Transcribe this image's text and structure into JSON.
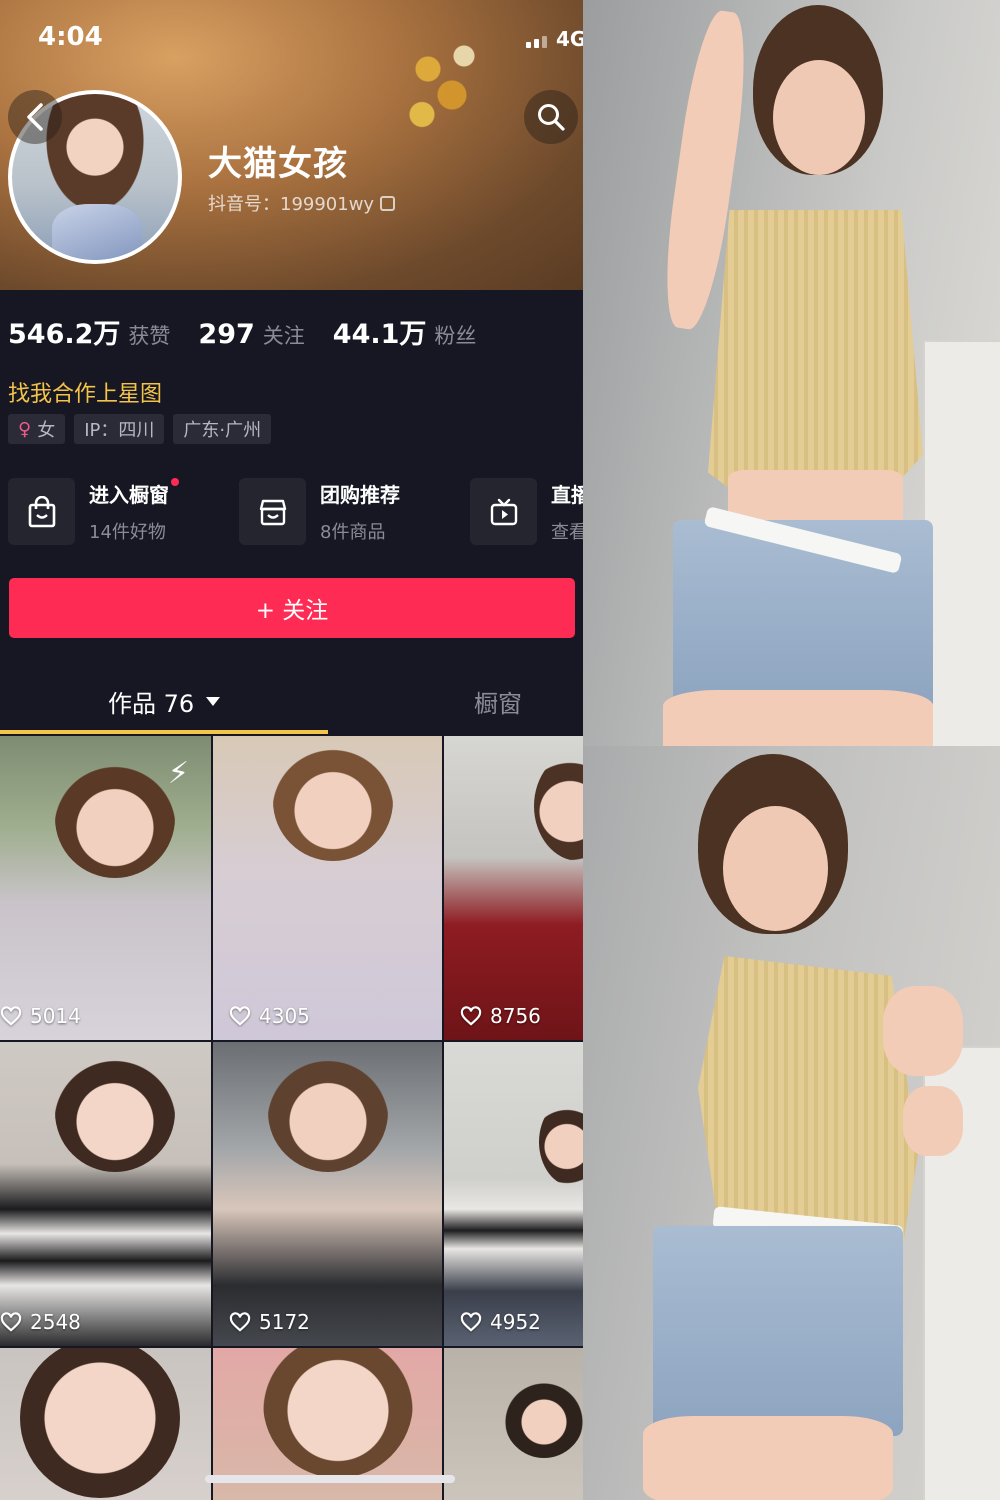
{
  "status": {
    "time": "4:04",
    "network": "4G"
  },
  "profile": {
    "nickname": "大猫女孩",
    "douyin_id": "抖音号：199901wy",
    "stats": [
      {
        "value": "546.2万",
        "label": "获赞"
      },
      {
        "value": "297",
        "label": "关注"
      },
      {
        "value": "44.1万",
        "label": "粉丝"
      }
    ],
    "promo": "找我合作上星图",
    "tags": [
      {
        "icon": "female-icon",
        "text": "女"
      },
      {
        "text": "IP：四川"
      },
      {
        "text": "广东·广州"
      }
    ]
  },
  "services": [
    {
      "icon": "shopping-bag-icon",
      "title": "进入橱窗",
      "subtitle": "14件好物",
      "has_dot": true
    },
    {
      "icon": "group-buy-icon",
      "title": "团购推荐",
      "subtitle": "8件商品"
    },
    {
      "icon": "tv-icon",
      "title": "直播",
      "subtitle": "查看"
    }
  ],
  "follow_button": {
    "label": "+ 关注"
  },
  "tabs": {
    "works_label": "作品 76",
    "window_label": "橱窗"
  },
  "videos": [
    {
      "likes": "5014"
    },
    {
      "likes": "4305"
    },
    {
      "likes": "8756"
    },
    {
      "likes": "2548"
    },
    {
      "likes": "5172"
    },
    {
      "likes": "4952"
    }
  ],
  "colors": {
    "accent_red": "#fe2c55",
    "promo_gold": "#f4c34a",
    "background": "#161722"
  }
}
